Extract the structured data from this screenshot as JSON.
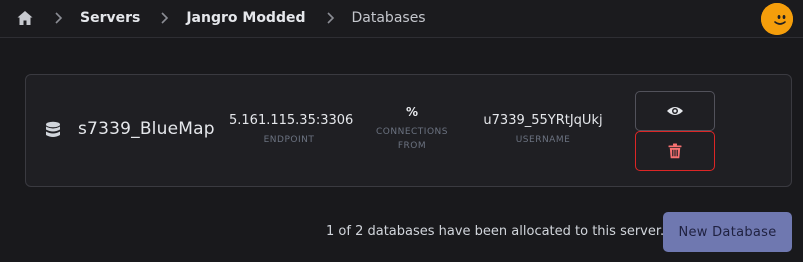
{
  "breadcrumb": {
    "home_icon": "home-icon",
    "items": [
      {
        "label": "Servers"
      },
      {
        "label": "Jangro Modded"
      }
    ],
    "current": "Databases"
  },
  "user": {
    "avatar_icon": "avatar-smiley",
    "color": "#f59e0b"
  },
  "database": {
    "icon": "database-icon",
    "name": "s7339_BlueMap",
    "endpoint": {
      "value": "5.161.115.35:3306",
      "label": "ENDPOINT"
    },
    "connections_from": {
      "value": "%",
      "label_line1": "CONNECTIONS",
      "label_line2": "FROM"
    },
    "username": {
      "value": "u7339_55YRtJqUkj",
      "label": "USERNAME"
    },
    "actions": {
      "view_icon": "eye-icon",
      "delete_icon": "trash-icon",
      "delete_color": "#f87171"
    }
  },
  "footer": {
    "allocation_text": "1 of 2 databases have been allocated to this server.",
    "new_button_label": "New Database",
    "new_button_color": "#6f78b0"
  }
}
